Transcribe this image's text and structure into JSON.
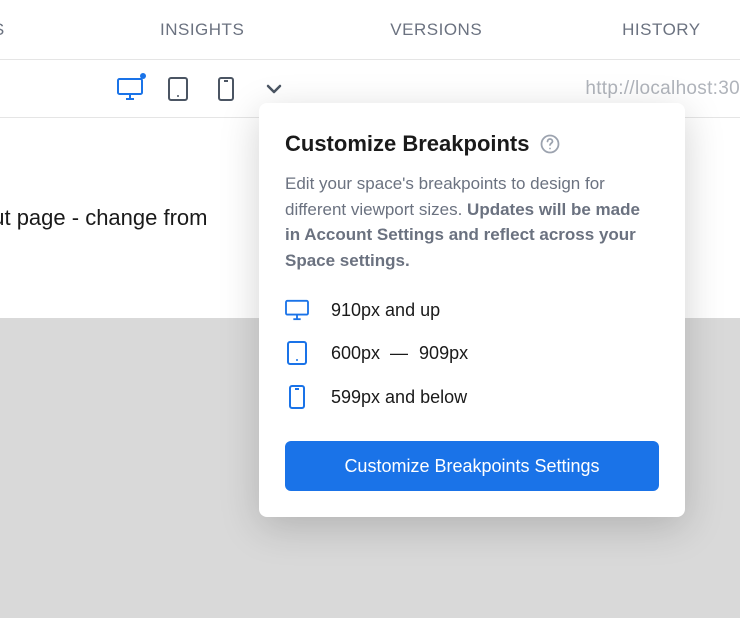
{
  "topnav": {
    "tab1": "TS",
    "tab2": "INSIGHTS",
    "tab3": "VERSIONS",
    "tab4": "HISTORY"
  },
  "toolbar": {
    "url": "http://localhost:30"
  },
  "content": {
    "page_text": "out page - change from"
  },
  "popover": {
    "title": "Customize Breakpoints",
    "desc_plain": "Edit your space's breakpoints to design for different viewport sizes. ",
    "desc_bold": "Updates will be made in Account Settings and reflect across your Space settings.",
    "breakpoints": {
      "desktop": "910px and up",
      "tablet_min": "600px",
      "tablet_dash": "—",
      "tablet_max": "909px",
      "mobile": "599px and below"
    },
    "cta": "Customize Breakpoints Settings"
  }
}
